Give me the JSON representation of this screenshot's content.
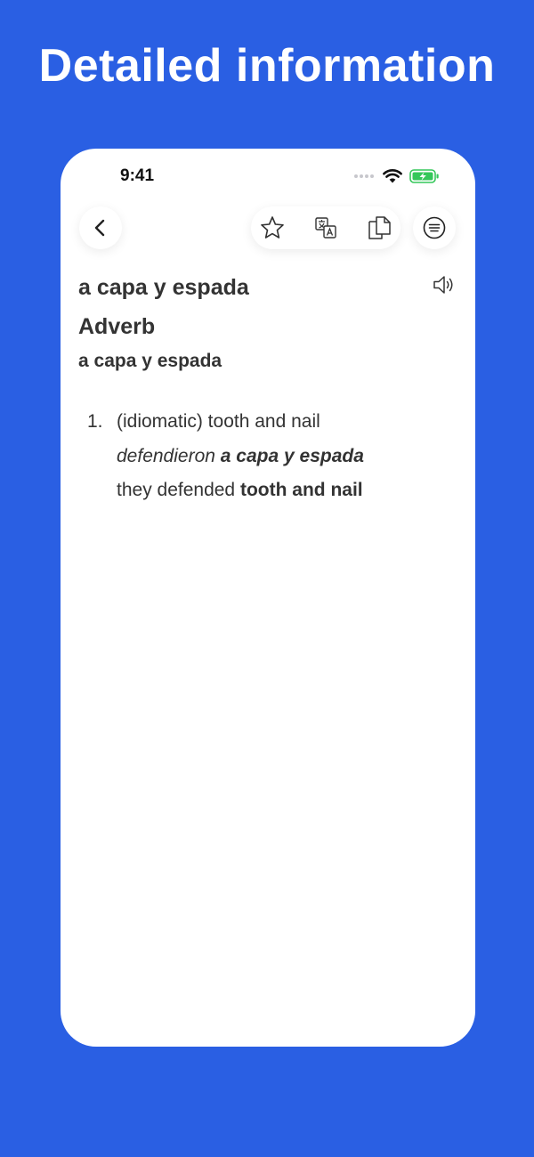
{
  "promo": {
    "title": "Detailed information"
  },
  "status_bar": {
    "time": "9:41"
  },
  "toolbar": {
    "icons": {
      "back": "chevron-left-icon",
      "favorite": "star-icon",
      "translate": "translate-icon",
      "copy": "copy-icon",
      "menu": "menu-lines-icon"
    }
  },
  "entry": {
    "headword": "a capa y espada",
    "part_of_speech": "Adverb",
    "form": "a capa y espada",
    "senses": [
      {
        "number": "1.",
        "definition": "(idiomatic) tooth and nail",
        "example_text": "defendieron",
        "example_highlight": "a capa y espada",
        "translation_text": "they defended",
        "translation_highlight": "tooth and nail"
      }
    ]
  },
  "colors": {
    "background": "#2A5FE3",
    "card": "#FFFFFF",
    "text": "#333333",
    "battery": "#34C759"
  }
}
